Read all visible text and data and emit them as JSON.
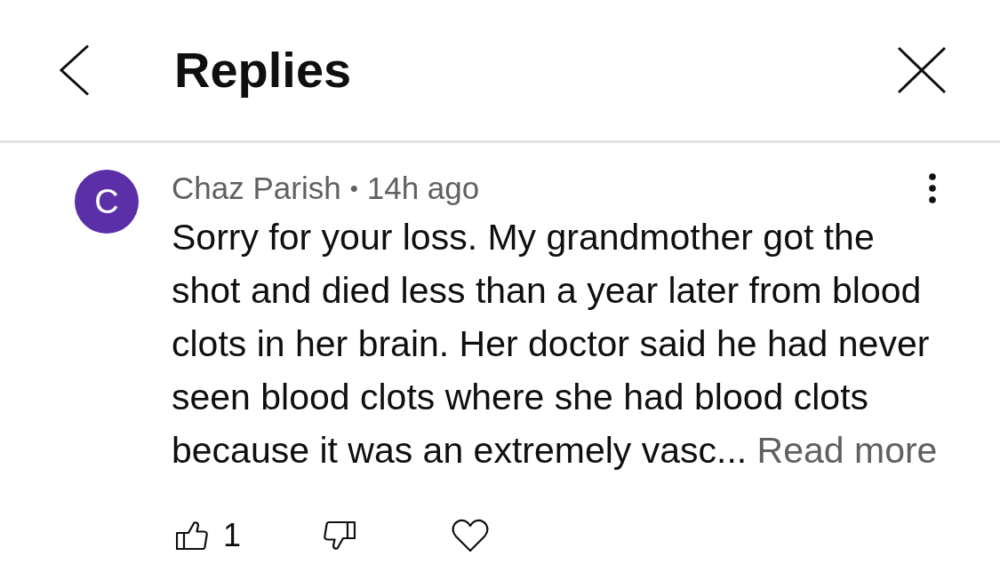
{
  "header": {
    "title": "Replies"
  },
  "comment": {
    "avatar_letter": "C",
    "author": "Chaz Parish",
    "separator": "•",
    "time": "14h ago",
    "text": "Sorry for your loss. My grandmother got the shot and died less than a year later from blood clots in her brain. Her doctor said he had never seen blood clots where she had blood clots because it was an extremely vasc...",
    "read_more": "Read more",
    "like_count": "1"
  }
}
